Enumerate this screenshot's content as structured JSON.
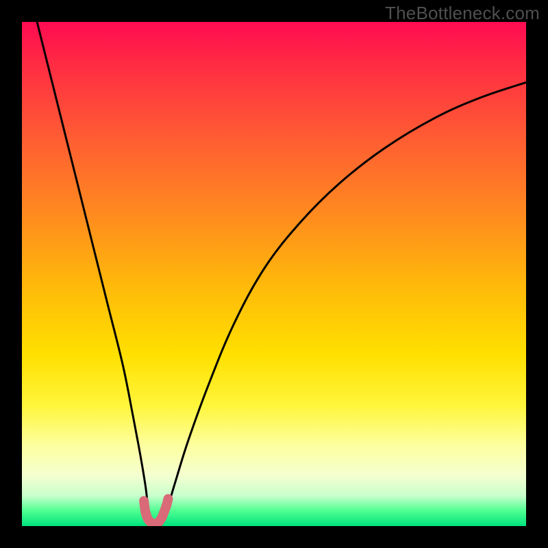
{
  "watermark": "TheBottleneck.com",
  "chart_data": {
    "type": "line",
    "title": "",
    "xlabel": "",
    "ylabel": "",
    "xlim": [
      0,
      100
    ],
    "ylim": [
      0,
      100
    ],
    "grid": false,
    "legend": false,
    "series": [
      {
        "name": "left-branch",
        "x": [
          3,
          5,
          8,
          11,
          14,
          17,
          20,
          22,
          23.5,
          24.5,
          25,
          25.5,
          26,
          26.5
        ],
        "y": [
          100,
          92,
          80,
          68,
          56,
          44,
          32,
          22,
          14,
          8,
          4,
          2,
          1,
          0
        ]
      },
      {
        "name": "right-branch",
        "x": [
          27.5,
          28,
          29,
          30.5,
          33,
          37,
          42,
          48,
          55,
          63,
          72,
          82,
          91,
          100
        ],
        "y": [
          0,
          1,
          4,
          9,
          17,
          28,
          40,
          51,
          60,
          68,
          75,
          81,
          85,
          88
        ]
      },
      {
        "name": "valley-marker",
        "note": "rounded pink U marker at bottom of notch",
        "x": [
          24.2,
          24.5,
          25.0,
          25.6,
          26.3,
          27.0,
          27.6,
          28.2,
          28.7,
          29.0
        ],
        "y": [
          5.0,
          2.8,
          1.4,
          0.7,
          0.5,
          0.7,
          1.4,
          2.8,
          4.2,
          5.4
        ]
      }
    ],
    "gradient_stops": [
      {
        "pos": 0.0,
        "color": "#ff0b52"
      },
      {
        "pos": 0.08,
        "color": "#ff2a43"
      },
      {
        "pos": 0.22,
        "color": "#ff5934"
      },
      {
        "pos": 0.38,
        "color": "#ff8a1f"
      },
      {
        "pos": 0.52,
        "color": "#ffb80a"
      },
      {
        "pos": 0.66,
        "color": "#ffe000"
      },
      {
        "pos": 0.76,
        "color": "#fff53a"
      },
      {
        "pos": 0.84,
        "color": "#fdff9f"
      },
      {
        "pos": 0.9,
        "color": "#f4ffd0"
      },
      {
        "pos": 0.94,
        "color": "#c8ffcc"
      },
      {
        "pos": 0.97,
        "color": "#4eff91"
      },
      {
        "pos": 1.0,
        "color": "#00e27e"
      }
    ],
    "colors": {
      "curve": "#000000",
      "marker": "#d96a77",
      "frame": "#000000"
    }
  }
}
